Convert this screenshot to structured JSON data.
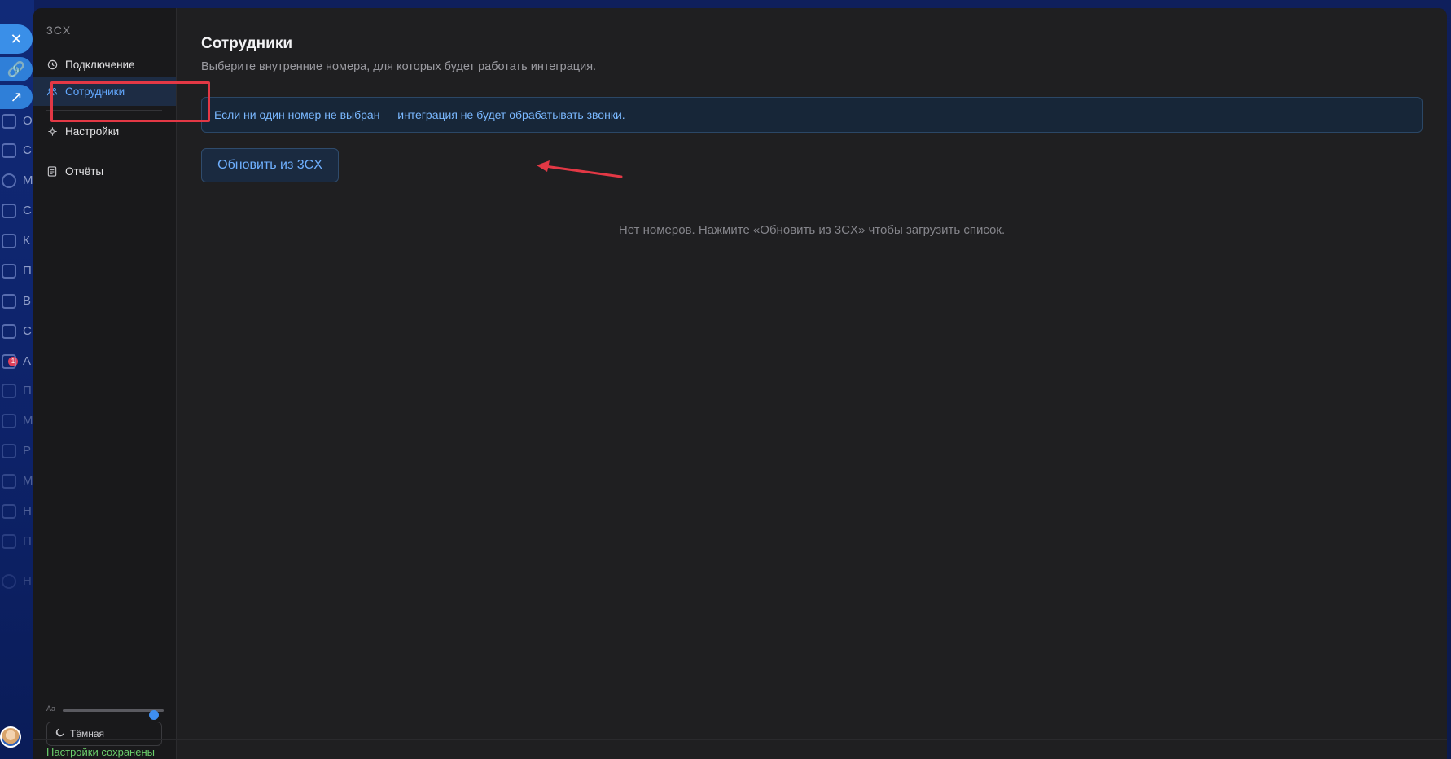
{
  "window": {
    "title": "3CX"
  },
  "sidebar": {
    "items": [
      {
        "label": "Подключение",
        "icon": "clock-icon"
      },
      {
        "label": "Сотрудники",
        "icon": "users-icon",
        "active": true
      },
      {
        "label": "Настройки",
        "icon": "gear-icon"
      },
      {
        "label": "Отчёты",
        "icon": "report-icon"
      }
    ],
    "font_size_label": "Aa",
    "font_size_value": 0.9,
    "theme_label": "Тёмная"
  },
  "main": {
    "title": "Сотрудники",
    "subtitle": "Выберите внутренние номера, для которых будет работать интеграция.",
    "info": "Если ни один номер не выбран — интеграция не будет обрабатывать звонки.",
    "refresh_button": "Обновить из 3CX",
    "empty_state": "Нет номеров. Нажмите «Обновить из 3CX» чтобы загрузить список."
  },
  "status": "Настройки сохранены",
  "background": {
    "rail_letters": [
      "О",
      "С",
      "М",
      "С",
      "К",
      "П",
      "В",
      "С",
      "А",
      "П",
      "М",
      "Р",
      "М",
      "Н",
      "П",
      "Н"
    ],
    "rail_badge": "1"
  },
  "colors": {
    "accent": "#63a9ff",
    "modal_bg": "#1f1f21",
    "sidebar_bg": "#19191b",
    "annotation": "#e33845",
    "success": "#6bd06b"
  }
}
